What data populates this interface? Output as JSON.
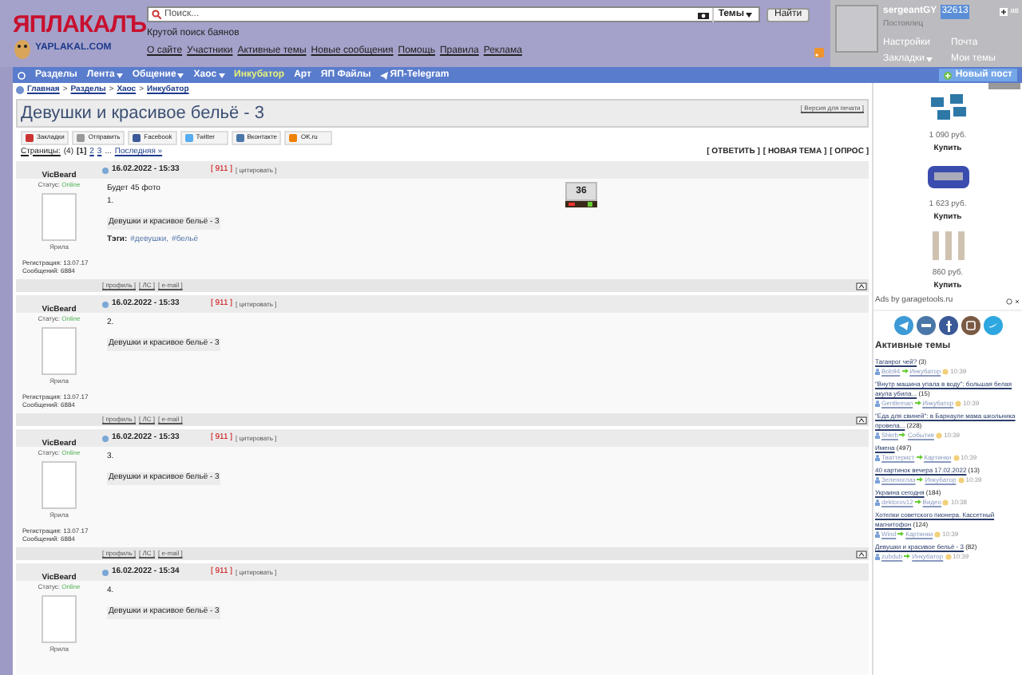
{
  "header": {
    "logo_text": "ЯПЛАКАЛЪ",
    "logo_domain": "YAPLAKAL.COM",
    "search": {
      "placeholder": "Поиск...",
      "scope": "Темы",
      "button": "Найти"
    },
    "tagline": "Крутой поиск баянов",
    "links": [
      "О сайте",
      "Участники",
      "Активные темы",
      "Новые сообщения",
      "Помощь",
      "Правила",
      "Реклама"
    ],
    "user": {
      "name": "sergeantGY",
      "count": "32613",
      "rank": "Постоялец",
      "corner": "ав",
      "links": [
        {
          "label": "Настройки",
          "dropdown": false
        },
        {
          "label": "Почта",
          "dropdown": false
        },
        {
          "label": "Закладки",
          "dropdown": true
        },
        {
          "label": "Мои темы",
          "dropdown": false
        }
      ]
    }
  },
  "nav": {
    "items": [
      {
        "label": "Разделы",
        "dropdown": false,
        "kind": "plain"
      },
      {
        "label": "Лента",
        "dropdown": true,
        "kind": "plain"
      },
      {
        "label": "Общение",
        "dropdown": true,
        "kind": "plain"
      },
      {
        "label": "Хаос",
        "dropdown": true,
        "kind": "plain"
      },
      {
        "label": "Инкубатор",
        "dropdown": false,
        "kind": "highlight"
      },
      {
        "label": "Арт",
        "dropdown": false,
        "kind": "plain"
      },
      {
        "label": "ЯП Файлы",
        "dropdown": false,
        "kind": "plain"
      },
      {
        "label": "ЯП-Telegram",
        "dropdown": false,
        "kind": "telegram"
      }
    ],
    "new_post": "Новый пост"
  },
  "breadcrumbs": [
    "Главная",
    "Разделы",
    "Хаос",
    "Инкубатор"
  ],
  "breadcrumb_separator": ">",
  "topic": {
    "title": "Девушки и красивое бельё - 3",
    "print": "[ Версия для печати ]",
    "share": [
      {
        "label": "Закладки",
        "color": "#cc3333"
      },
      {
        "label": "Отправить",
        "color": "#999999"
      },
      {
        "label": "Facebook",
        "color": "#3b5998"
      },
      {
        "label": "Twitter",
        "color": "#55acee"
      },
      {
        "label": "Вконтакте",
        "color": "#4a76a8"
      },
      {
        "label": "OK.ru",
        "color": "#ee8208"
      }
    ],
    "pages": {
      "label": "Страницы:",
      "count": "(4)",
      "items": [
        {
          "label": "[1]",
          "selected": true
        },
        {
          "label": "2",
          "selected": false
        },
        {
          "label": "3",
          "selected": false
        }
      ],
      "ellipsis": "...",
      "last": "Последняя »"
    },
    "actions": [
      "[ ОТВЕТИТЬ ]",
      "[ НОВАЯ ТЕМА ]",
      "[ ОПРОС ]"
    ]
  },
  "posts": [
    {
      "author": "VicBeard",
      "date": "16.02.2022 - 15:33",
      "number": "[ 911 ]",
      "quote": "[ цитировать ]",
      "status_label": "Статус:",
      "status": "Online",
      "avatar_caption": "Ярила",
      "registration": "Регистрация: 13.07.17",
      "messages": "Сообщений: 6884",
      "lines": [
        "Будет 45 фото",
        "1."
      ],
      "image_alt": "Девушки и красивое бельё - 3",
      "tags_label": "Тэги:",
      "tags": [
        "#девушки,",
        "#бельё"
      ],
      "rating": "36",
      "footer": [
        "[ профиль ]",
        "[ ЛС ]",
        "[ e-mail ]"
      ]
    },
    {
      "author": "VicBeard",
      "date": "16.02.2022 - 15:33",
      "number": "[ 911 ]",
      "quote": "[ цитировать ]",
      "status_label": "Статус:",
      "status": "Online",
      "avatar_caption": "Ярила",
      "registration": "Регистрация: 13.07.17",
      "messages": "Сообщений: 6884",
      "lines": [
        "2."
      ],
      "image_alt": "Девушки и красивое бельё - 3",
      "footer": [
        "[ профиль ]",
        "[ ЛС ]",
        "[ e-mail ]"
      ]
    },
    {
      "author": "VicBeard",
      "date": "16.02.2022 - 15:33",
      "number": "[ 911 ]",
      "quote": "[ цитировать ]",
      "status_label": "Статус:",
      "status": "Online",
      "avatar_caption": "Ярила",
      "registration": "Регистрация: 13.07.17",
      "messages": "Сообщений: 6884",
      "lines": [
        "3."
      ],
      "image_alt": "Девушки и красивое бельё - 3",
      "footer": [
        "[ профиль ]",
        "[ ЛС ]",
        "[ e-mail ]"
      ]
    },
    {
      "author": "VicBeard",
      "date": "16.02.2022 - 15:34",
      "number": "[ 911 ]",
      "quote": "[ цитировать ]",
      "status_label": "Статус:",
      "status": "Online",
      "avatar_caption": "Ярила",
      "lines": [
        "4."
      ],
      "image_alt": "Девушки и красивое бельё - 3"
    }
  ],
  "ad": {
    "products": [
      {
        "price": "1 090 руб.",
        "buy": "Купить"
      },
      {
        "price": "1 623 руб.",
        "buy": "Купить"
      },
      {
        "price": "860 руб.",
        "buy": "Купить"
      }
    ],
    "source": "Ads by garagetools.ru"
  },
  "social": [
    {
      "kind": "telegram",
      "color": "#3d9ad6"
    },
    {
      "kind": "vk",
      "color": "#4a76a8"
    },
    {
      "kind": "facebook",
      "color": "#3b5998"
    },
    {
      "kind": "instagram",
      "color": "#7a5a44"
    },
    {
      "kind": "twitter",
      "color": "#2ea7e0"
    }
  ],
  "active_topics": {
    "title": "Активные темы",
    "items": [
      {
        "title": "Таганрог чей?",
        "count": "(3)",
        "user": "Bob94",
        "section": "Инкубатор",
        "time": "10:39"
      },
      {
        "title": "\"Внутр машина упала в воду\": большая белая акула убила...",
        "count": "(15)",
        "user": "Gentleman",
        "section": "Инкубатор",
        "time": "10:39"
      },
      {
        "title": "\"Еда для свиней\": в Барнауле мама школьника провела...",
        "count": "(228)",
        "user": "Shkrb",
        "section": "События",
        "time": "10:39"
      },
      {
        "title": "Имена",
        "count": "(497)",
        "user": "Тваттерист",
        "section": "Картинки",
        "time": "10:39"
      },
      {
        "title": "40 картинок вечера 17.02.2022",
        "count": "(13)",
        "user": "Зеленоглаз",
        "section": "Инкубатор",
        "time": "10:39"
      },
      {
        "title": "Украина сегодня",
        "count": "(184)",
        "user": "dektorov12",
        "section": "Видео",
        "time": "10:38"
      },
      {
        "title": "Хотелки советского пионера. Кассетный магнитофон",
        "count": "(124)",
        "user": "Wind",
        "section": "Картинки",
        "time": "10:39"
      },
      {
        "title": "Девушки и красивое бельё - 3",
        "count": "(82)",
        "user": "zubdub",
        "section": "Инкубатор",
        "time": "10:39"
      }
    ]
  }
}
